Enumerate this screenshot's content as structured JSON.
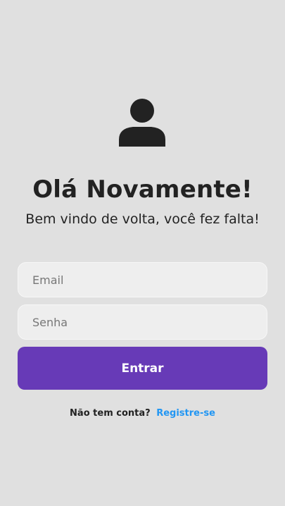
{
  "header": {
    "icon": "user-icon",
    "title": "Olá Novamente!",
    "subtitle": "Bem vindo de volta, você fez falta!"
  },
  "form": {
    "email_placeholder": "Email",
    "email_value": "",
    "password_placeholder": "Senha",
    "password_value": "",
    "submit_label": "Entrar"
  },
  "footer": {
    "question": "Não tem conta?",
    "register_link": "Registre-se"
  },
  "colors": {
    "background": "#e0e0e0",
    "primary": "#673ab7",
    "link": "#2196f3",
    "text": "#222222"
  }
}
